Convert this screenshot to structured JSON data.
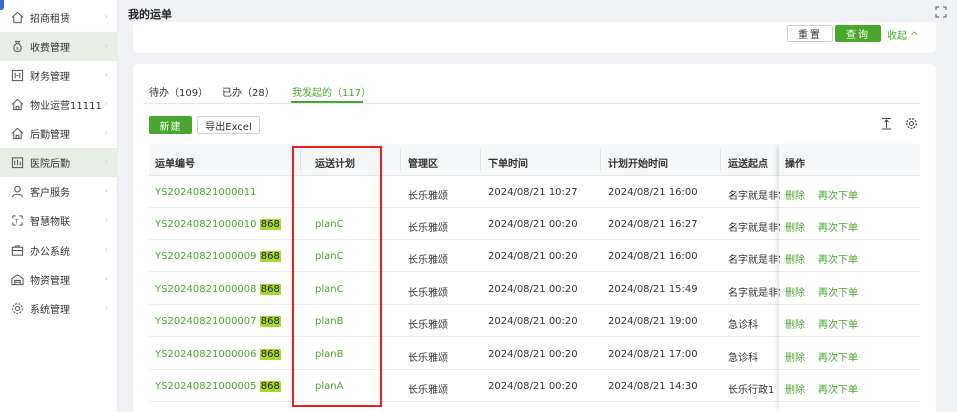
{
  "sidebar": {
    "items": [
      {
        "label": "招商租赁",
        "icon": "home-icon",
        "active": false
      },
      {
        "label": "收费管理",
        "icon": "money-bag-icon",
        "active": true
      },
      {
        "label": "财务管理",
        "icon": "finance-icon",
        "active": false
      },
      {
        "label": "物业运营11111",
        "icon": "building-icon",
        "active": false
      },
      {
        "label": "后勤管理",
        "icon": "house-icon",
        "active": false
      },
      {
        "label": "医院后勤",
        "icon": "hospital-icon",
        "active": true
      },
      {
        "label": "客户服务",
        "icon": "user-icon",
        "active": false
      },
      {
        "label": "智慧物联",
        "icon": "iot-icon",
        "active": false
      },
      {
        "label": "办公系统",
        "icon": "office-icon",
        "active": false
      },
      {
        "label": "物资管理",
        "icon": "warehouse-icon",
        "active": false
      },
      {
        "label": "系统管理",
        "icon": "gear-icon",
        "active": false
      }
    ]
  },
  "header": {
    "title": "我的运单"
  },
  "filter": {
    "reset_label": "重置",
    "query_label": "查询",
    "collapse_label": "收起 ^"
  },
  "tabs": [
    {
      "label": "待办（109）"
    },
    {
      "label": "已办（28）"
    },
    {
      "label": "我发起的（117）"
    }
  ],
  "toolbar": {
    "new_label": "新建",
    "export_label": "导出Excel"
  },
  "table": {
    "headers": [
      "运单编号",
      "运送计划",
      "管理区",
      "下单时间",
      "计划开始时间",
      "运送起点",
      "操作"
    ],
    "rows": [
      {
        "id": "YS20240821000011",
        "badge": "",
        "plan": "",
        "area": "长乐雅颂",
        "order_time": "2024/08/21 10:27",
        "start_time": "2024/08/21 16:00",
        "origin": "名字就是非常",
        "delete": "删除",
        "reorder": "再次下单"
      },
      {
        "id": "YS20240821000010",
        "badge": "868",
        "plan": "planC",
        "area": "长乐雅颂",
        "order_time": "2024/08/21 00:20",
        "start_time": "2024/08/21 16:27",
        "origin": "名字就是非常",
        "delete": "删除",
        "reorder": "再次下单"
      },
      {
        "id": "YS20240821000009",
        "badge": "868",
        "plan": "planC",
        "area": "长乐雅颂",
        "order_time": "2024/08/21 00:20",
        "start_time": "2024/08/21 16:00",
        "origin": "名字就是非常",
        "delete": "删除",
        "reorder": "再次下单"
      },
      {
        "id": "YS20240821000008",
        "badge": "868",
        "plan": "planC",
        "area": "长乐雅颂",
        "order_time": "2024/08/21 00:20",
        "start_time": "2024/08/21 15:49",
        "origin": "名字就是非常",
        "delete": "删除",
        "reorder": "再次下单"
      },
      {
        "id": "YS20240821000007",
        "badge": "868",
        "plan": "planB",
        "area": "长乐雅颂",
        "order_time": "2024/08/21 00:20",
        "start_time": "2024/08/21 19:00",
        "origin": "急诊科",
        "delete": "删除",
        "reorder": "再次下单"
      },
      {
        "id": "YS20240821000006",
        "badge": "868",
        "plan": "planB",
        "area": "长乐雅颂",
        "order_time": "2024/08/21 00:20",
        "start_time": "2024/08/21 17:00",
        "origin": "急诊科",
        "delete": "删除",
        "reorder": "再次下单"
      },
      {
        "id": "YS20240821000005",
        "badge": "868",
        "plan": "planA",
        "area": "长乐雅颂",
        "order_time": "2024/08/21 00:20",
        "start_time": "2024/08/21 14:30",
        "origin": "长乐行政1",
        "delete": "删除",
        "reorder": "再次下单"
      }
    ]
  },
  "colors": {
    "accent": "#4aa72e",
    "highlight": "#a7d82c",
    "annotation": "#e8231e"
  }
}
